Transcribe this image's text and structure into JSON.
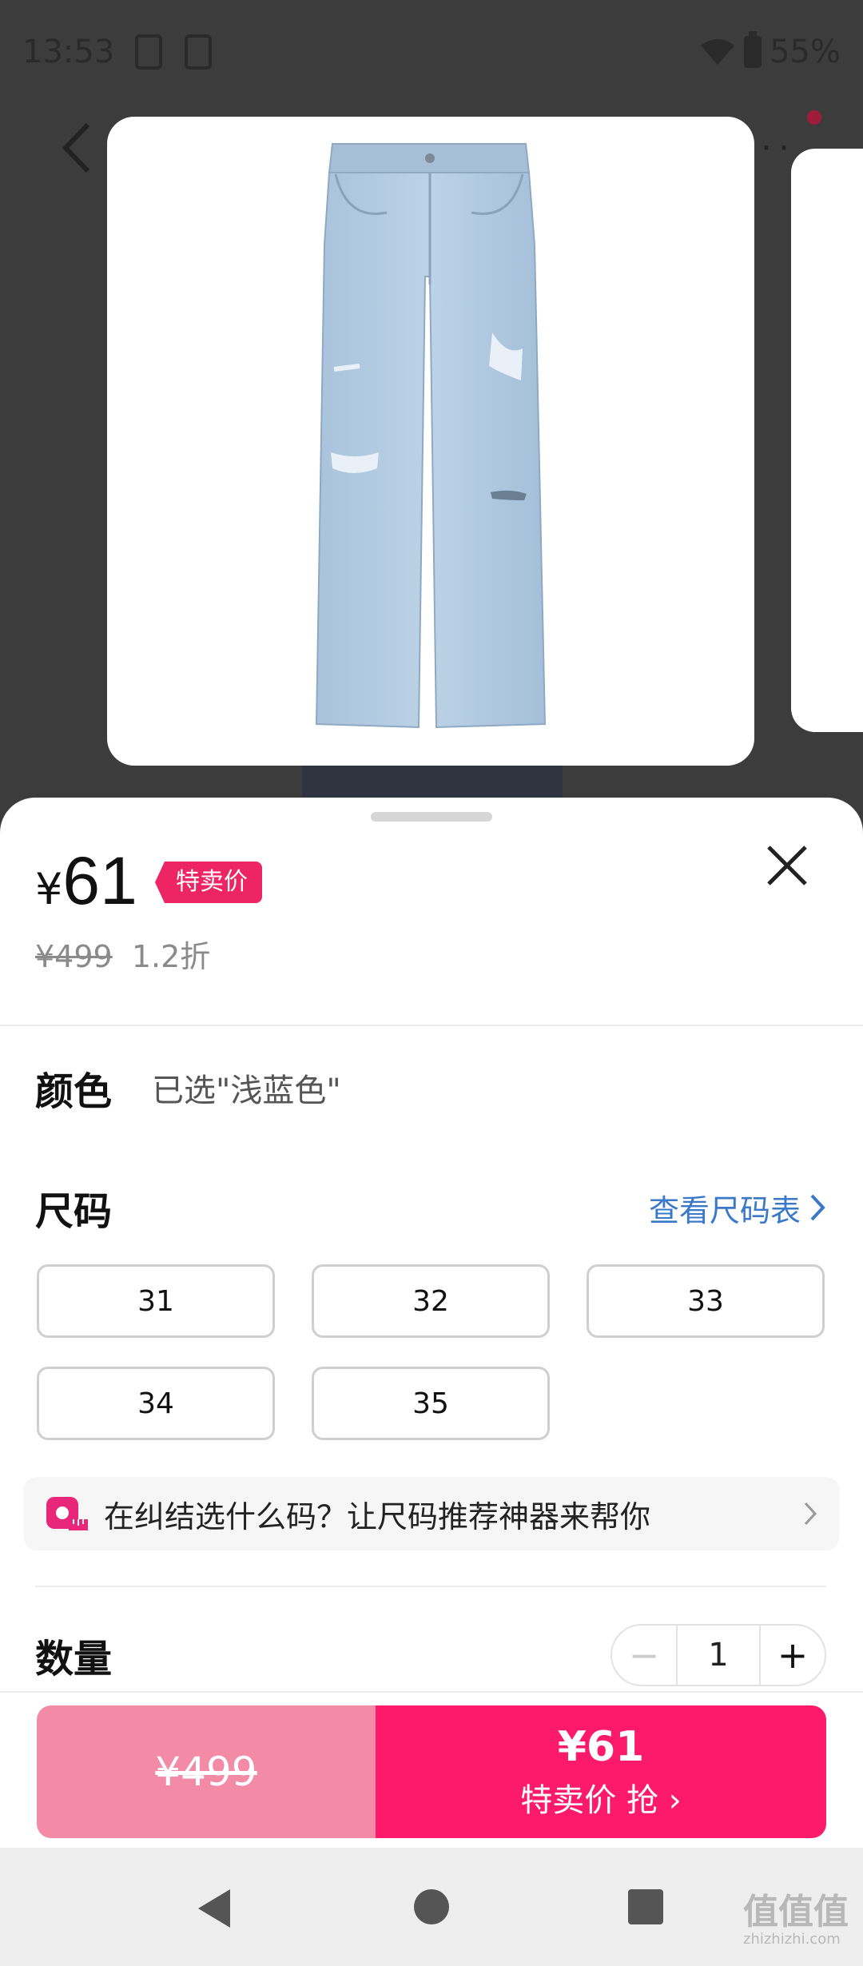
{
  "status_bar": {
    "time": "13:53",
    "battery": "55%"
  },
  "product": {
    "image_alt": "light blue distressed jeans"
  },
  "sheet": {
    "currency": "¥",
    "price": "61",
    "price_tag": "特卖价",
    "original_price": "¥499",
    "discount": "1.2折",
    "color_label": "颜色",
    "color_selected": "已选\"浅蓝色\"",
    "size_label": "尺码",
    "size_chart_link": "查看尺码表",
    "sizes": [
      "31",
      "32",
      "33",
      "34",
      "35"
    ],
    "recommend_text": "在纠结选什么码？让尺码推荐神器来帮你",
    "quantity_label": "数量",
    "quantity_value": "1",
    "quantity_minus": "−",
    "quantity_plus": "+"
  },
  "actions": {
    "original_price_button": "¥499",
    "buy_price": "¥61",
    "buy_label": "特卖价 抢 ›"
  },
  "system_nav": {
    "watermark": "值值值",
    "watermark_sub": "zhizhizhi.com"
  },
  "colors": {
    "accent": "#fd1a6a",
    "accent_light": "#f38ba6",
    "link": "#3a78c8"
  }
}
